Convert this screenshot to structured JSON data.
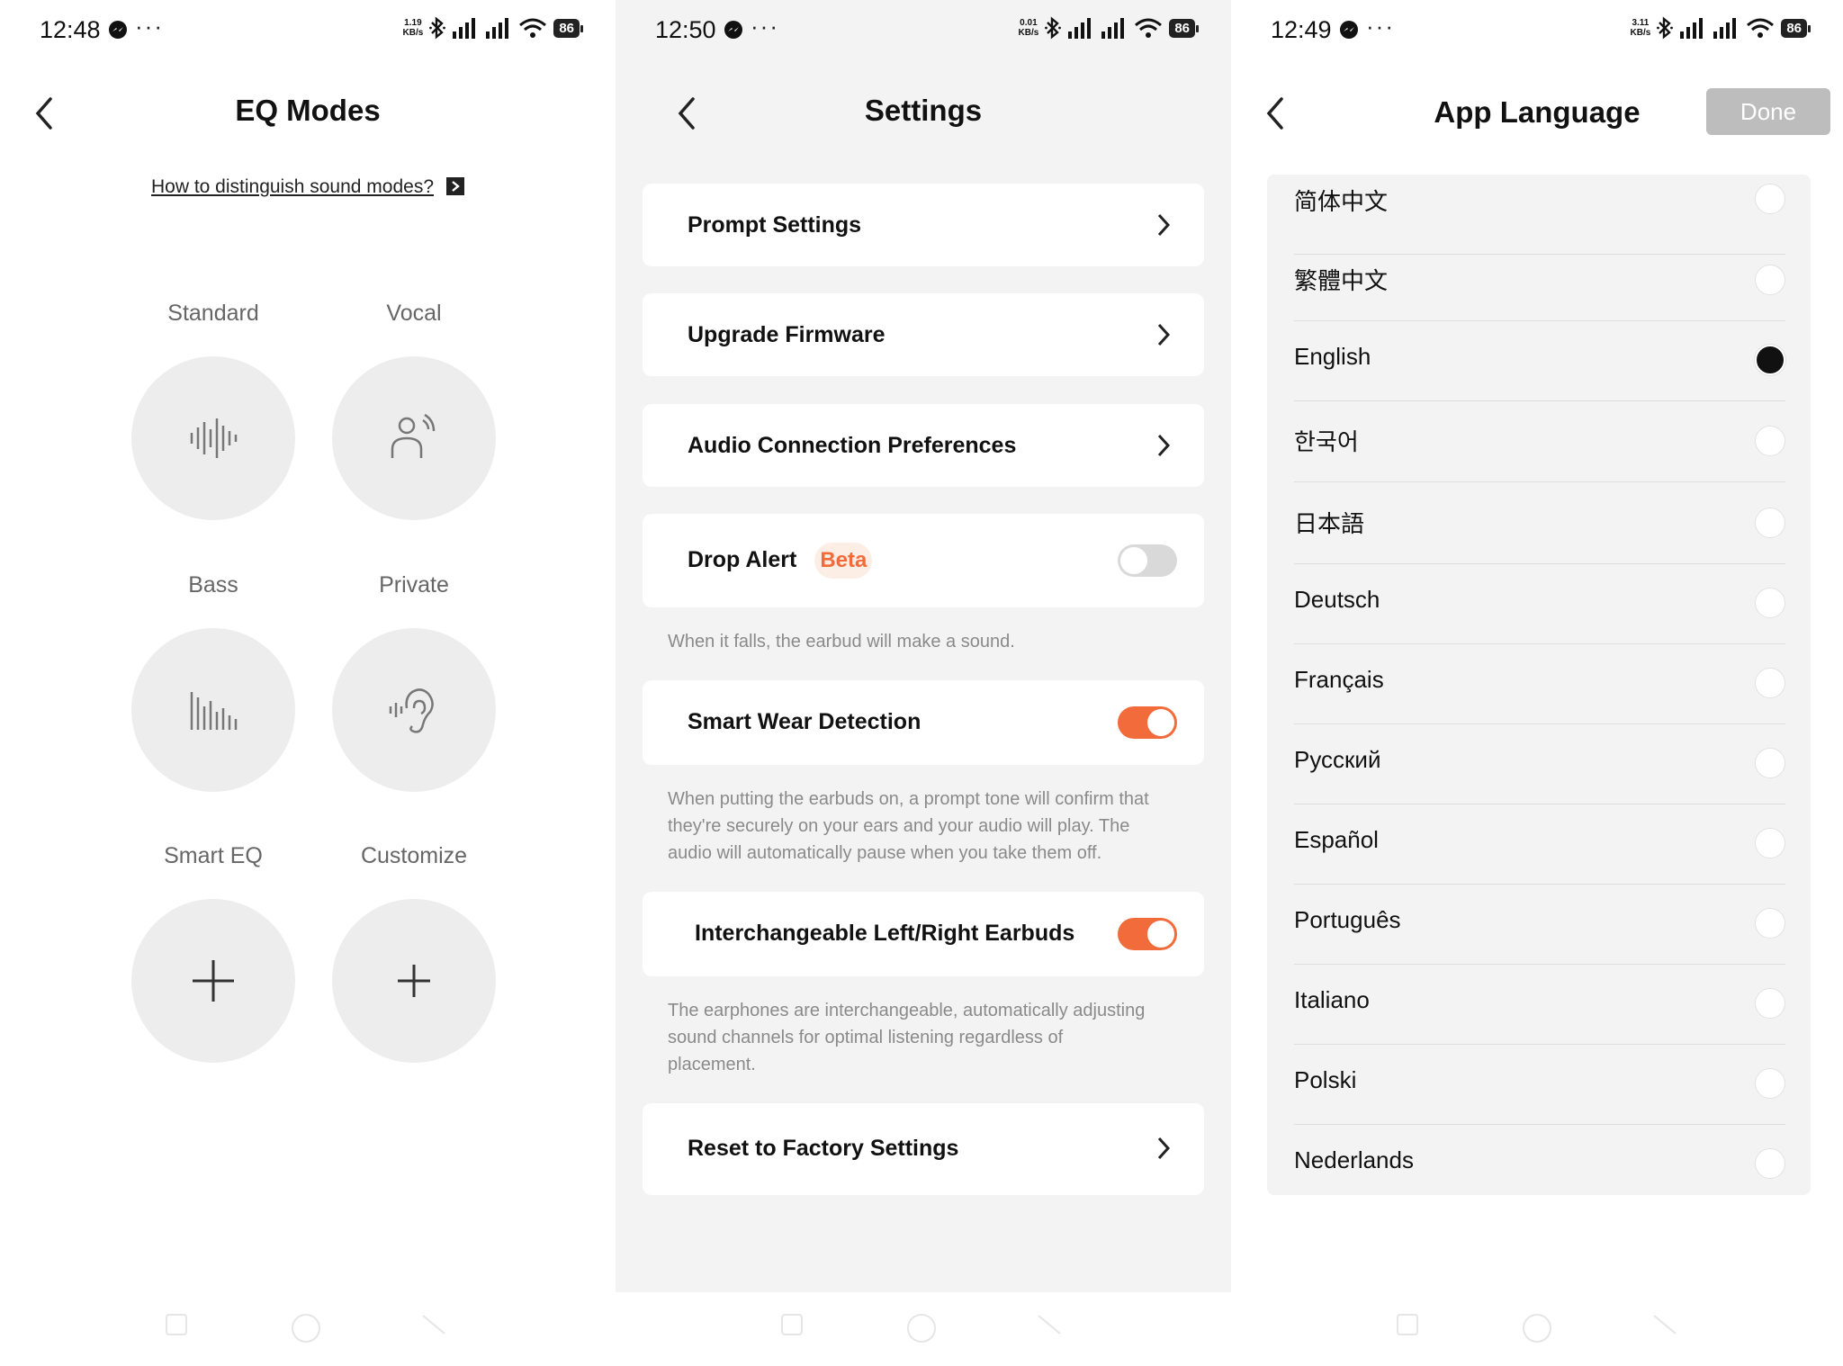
{
  "panels": {
    "eq": {
      "status": {
        "time": "12:48",
        "speed": "1.19",
        "speed_unit": "KB/s",
        "battery": "86"
      },
      "title": "EQ Modes",
      "howto_link": "How to distinguish sound modes?",
      "modes": [
        {
          "label": "Standard",
          "icon": "waveform-icon"
        },
        {
          "label": "Vocal",
          "icon": "person-voice-icon"
        },
        {
          "label": "Bass",
          "icon": "bass-bars-icon"
        },
        {
          "label": "Private",
          "icon": "ear-icon"
        },
        {
          "label": "Smart EQ",
          "icon": "plus-icon"
        },
        {
          "label": "Customize",
          "icon": "plus-icon"
        }
      ]
    },
    "settings": {
      "status": {
        "time": "12:50",
        "speed": "0.01",
        "speed_unit": "KB/s",
        "battery": "86"
      },
      "title": "Settings",
      "prompt_settings": "Prompt Settings",
      "upgrade_firmware": "Upgrade Firmware",
      "audio_connection": "Audio Connection Preferences",
      "drop_alert": {
        "label": "Drop Alert",
        "badge": "Beta",
        "enabled": false,
        "desc": "When it falls, the earbud will make a sound."
      },
      "smart_wear": {
        "label": "Smart Wear Detection",
        "enabled": true,
        "desc_lines": [
          "When putting the earbuds on, a prompt tone will confirm that",
          "they're securely on your ears and your audio will play. The",
          "audio will automatically pause when you take them off."
        ]
      },
      "interchangeable": {
        "label": "Interchangeable Left/Right Earbuds",
        "enabled": true,
        "desc_lines": [
          "The earphones are interchangeable, automatically adjusting",
          "sound channels for optimal listening regardless of",
          "placement."
        ]
      },
      "reset": "Reset to Factory Settings"
    },
    "language": {
      "status": {
        "time": "12:49",
        "speed": "3.11",
        "speed_unit": "KB/s",
        "battery": "86"
      },
      "title": "App Language",
      "done_label": "Done",
      "languages": [
        {
          "name": "简体中文",
          "selected": false
        },
        {
          "name": "繁體中文",
          "selected": false
        },
        {
          "name": "English",
          "selected": true
        },
        {
          "name": "한국어",
          "selected": false
        },
        {
          "name": "日本語",
          "selected": false
        },
        {
          "name": "Deutsch",
          "selected": false
        },
        {
          "name": "Français",
          "selected": false
        },
        {
          "name": "Русский",
          "selected": false
        },
        {
          "name": "Español",
          "selected": false
        },
        {
          "name": "Português",
          "selected": false
        },
        {
          "name": "Italiano",
          "selected": false
        },
        {
          "name": "Polski",
          "selected": false
        },
        {
          "name": "Nederlands",
          "selected": false
        }
      ]
    }
  },
  "colors": {
    "accent": "#f26b3a",
    "done_button": "#bdbdbd",
    "circle_bg": "#ededed"
  }
}
